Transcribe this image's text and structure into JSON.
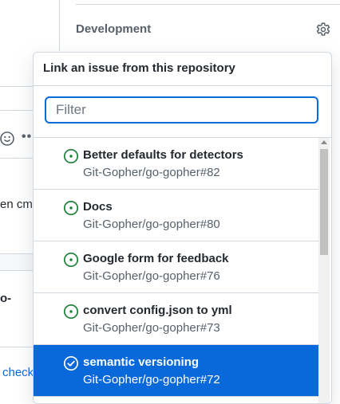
{
  "sidebar": {
    "section_title": "Development",
    "gear_icon": "gear-icon"
  },
  "background": {
    "text_fragment_1": "en cm",
    "text_fragment_2": "o-",
    "link_fragment": "check"
  },
  "popover": {
    "title": "Link an issue from this repository",
    "filter": {
      "placeholder": "Filter",
      "value": ""
    },
    "items": [
      {
        "title": "Better defaults for detectors",
        "ref": "Git-Gopher/go-gopher#82",
        "icon": "issue-opened-icon"
      },
      {
        "title": "Docs",
        "ref": "Git-Gopher/go-gopher#80",
        "icon": "issue-opened-icon"
      },
      {
        "title": "Google form for feedback",
        "ref": "Git-Gopher/go-gopher#76",
        "icon": "issue-opened-icon"
      },
      {
        "title": "convert config.json to yml",
        "ref": "Git-Gopher/go-gopher#73",
        "icon": "issue-opened-icon"
      },
      {
        "title": "semantic versioning",
        "ref": "Git-Gopher/go-gopher#72",
        "icon": "issue-closed-icon",
        "selected": true
      }
    ]
  },
  "colors": {
    "accent": "#0969da",
    "open_issue": "#1a7f37",
    "border": "#d0d7de"
  }
}
